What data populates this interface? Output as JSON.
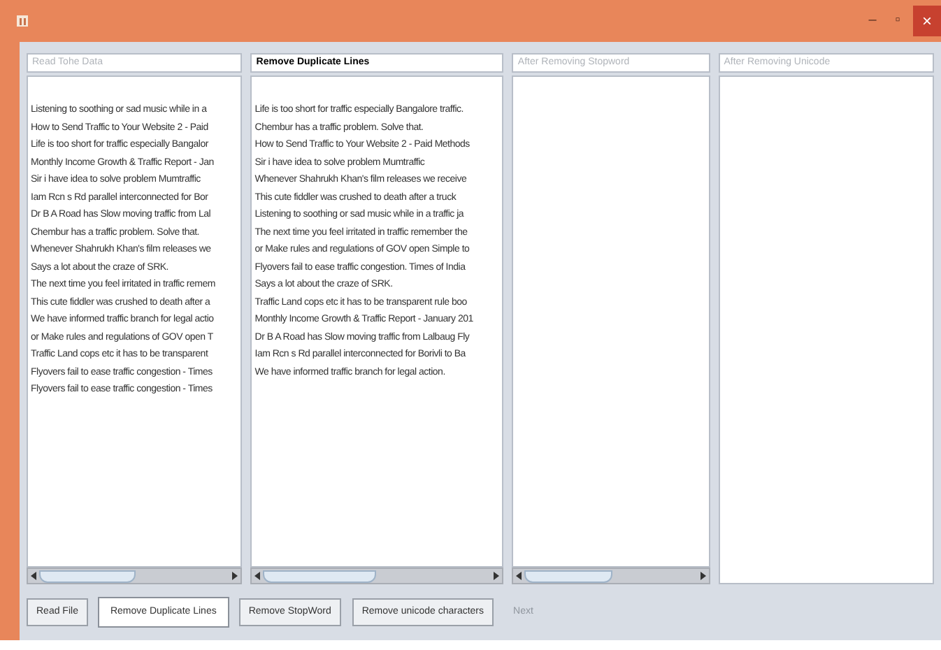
{
  "window": {
    "controls": [
      "–",
      "▫",
      "×"
    ]
  },
  "panels": [
    {
      "title": "Read Tohe Data",
      "active": false,
      "scrollbar": true,
      "lines": [
        "Listening to soothing or sad music while in a",
        "How to Send Traffic to Your Website 2 - Paid",
        "Life is too short for traffic especially Bangalor",
        "Monthly Income Growth & Traffic Report - Jan",
        "Sir i have idea to solve problem Mumtraffic",
        "Iam Rcn s Rd parallel interconnected for Bor",
        "Dr B A Road has Slow moving traffic from Lal",
        "Chembur has a traffic problem. Solve that.",
        "Whenever Shahrukh Khan's film releases we",
        "Says a lot about the craze of SRK.",
        "The next time you feel irritated in traffic remem",
        "This cute fiddler was crushed to death after a",
        "We have informed traffic branch for legal actio",
        "or Make rules and regulations of GOV open T",
        "Traffic Land cops etc it has to be transparent",
        "Flyovers fail to ease traffic congestion - Times",
        "Flyovers fail to ease traffic congestion - Times"
      ]
    },
    {
      "title": "Remove Duplicate Lines",
      "active": true,
      "scrollbar": true,
      "lines": [
        "Life is too short for traffic especially Bangalore traffic.",
        "Chembur has a traffic problem. Solve that.",
        "How to Send Traffic to Your Website 2 - Paid Methods",
        "Sir i have idea to solve problem Mumtraffic",
        "Whenever Shahrukh Khan's film releases we receive",
        "This cute fiddler was crushed to death after a truck",
        "Listening to soothing or sad music while in a traffic ja",
        "The next time you feel irritated in traffic remember the",
        "or Make rules and regulations of GOV open Simple to",
        "Flyovers fail to ease traffic congestion. Times of India",
        "Says a lot about the craze of SRK.",
        "Traffic Land cops etc it has to be transparent rule boo",
        "Monthly Income Growth & Traffic Report - January 201",
        "Dr B A Road has Slow moving traffic from Lalbaug Fly",
        "Iam Rcn s Rd parallel interconnected for Borivli to Ba",
        "We have informed traffic branch for legal action."
      ]
    },
    {
      "title": "After Removing Stopword",
      "active": false,
      "scrollbar": true
    },
    {
      "title": "After Removing Unicode",
      "active": false,
      "scrollbar": false
    }
  ],
  "buttons": [
    {
      "label": "Read File",
      "selected": false,
      "disabled": false
    },
    {
      "label": "Remove Duplicate Lines",
      "selected": true,
      "disabled": false
    },
    {
      "label": "Remove StopWord",
      "selected": false,
      "disabled": false
    },
    {
      "label": "Remove unicode characters",
      "selected": false,
      "disabled": false
    },
    {
      "label": "Next",
      "selected": false,
      "disabled": true
    }
  ]
}
